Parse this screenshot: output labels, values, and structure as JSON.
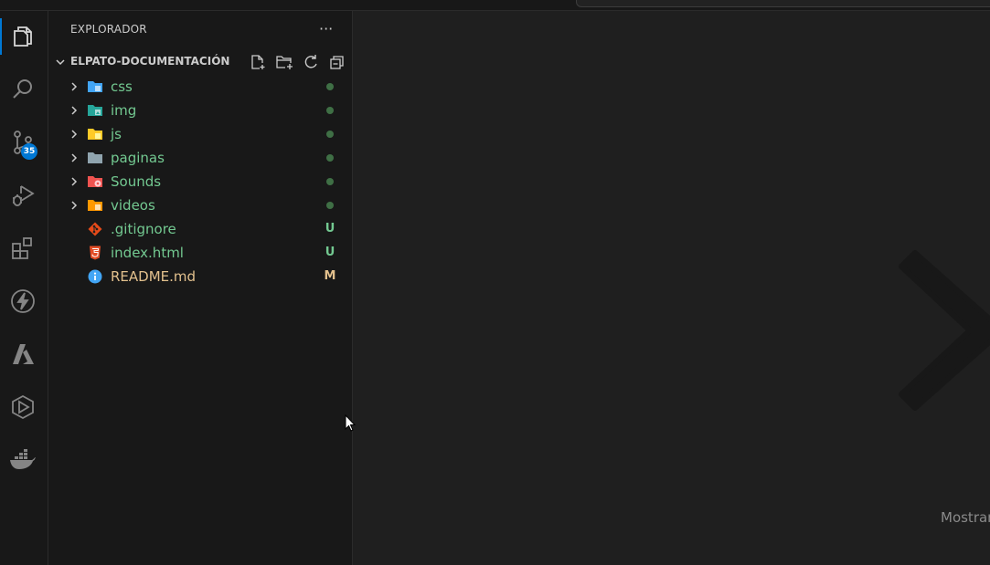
{
  "explorer": {
    "title": "EXPLORADOR",
    "more": "···",
    "folder_name": "ELPATO-DOCUMENTACIÓN",
    "items": [
      {
        "label": "css",
        "type": "folder",
        "icon": "folder-css-icon",
        "icon_color": "#42a5f5",
        "label_color": "#73c991",
        "status": "dot"
      },
      {
        "label": "img",
        "type": "folder",
        "icon": "folder-images-icon",
        "icon_color": "#26a69a",
        "label_color": "#73c991",
        "status": "dot"
      },
      {
        "label": "js",
        "type": "folder",
        "icon": "folder-js-icon",
        "icon_color": "#ffca28",
        "label_color": "#73c991",
        "status": "dot"
      },
      {
        "label": "paginas",
        "type": "folder",
        "icon": "folder-icon",
        "icon_color": "#90a4ae",
        "label_color": "#73c991",
        "status": "dot"
      },
      {
        "label": "Sounds",
        "type": "folder",
        "icon": "folder-audio-icon",
        "icon_color": "#ef5350",
        "label_color": "#73c991",
        "status": "dot"
      },
      {
        "label": "videos",
        "type": "folder",
        "icon": "folder-video-icon",
        "icon_color": "#ff9800",
        "label_color": "#73c991",
        "status": "dot"
      },
      {
        "label": ".gitignore",
        "type": "file",
        "icon": "git-file-icon",
        "icon_color": "#e64a19",
        "label_color": "#73c991",
        "status": "U",
        "status_color": "#73c991"
      },
      {
        "label": "index.html",
        "type": "file",
        "icon": "html5-file-icon",
        "icon_color": "#e44d26",
        "label_color": "#73c991",
        "status": "U",
        "status_color": "#73c991"
      },
      {
        "label": "README.md",
        "type": "file",
        "icon": "info-file-icon",
        "icon_color": "#42a5f5",
        "label_color": "#e2c08d",
        "status": "M",
        "status_color": "#e2c08d"
      }
    ]
  },
  "activity": {
    "source_control_badge": "35"
  },
  "editor": {
    "hint_text": "Mostrar"
  },
  "colors": {
    "accent": "#0078d4",
    "untracked": "#73c991",
    "modified": "#e2c08d"
  }
}
